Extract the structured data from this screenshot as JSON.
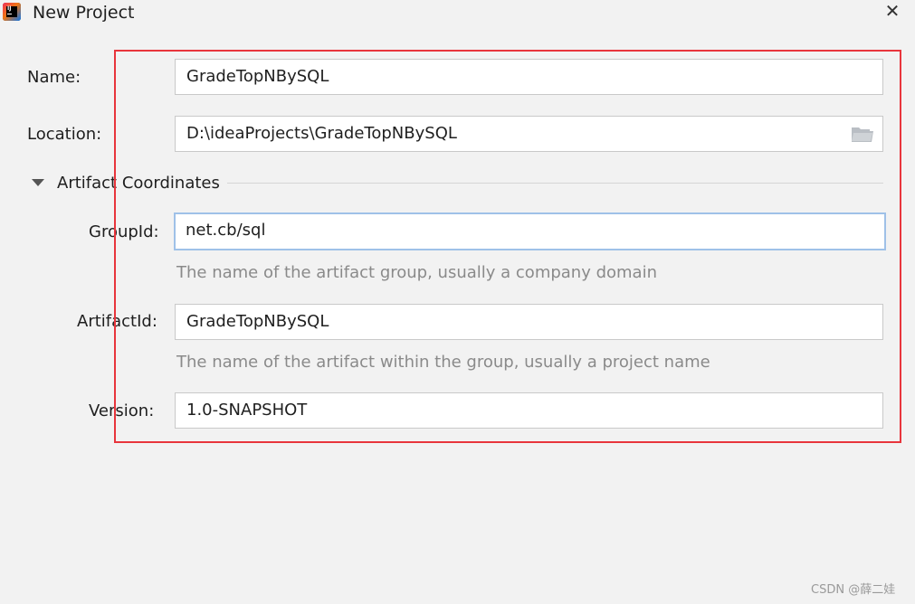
{
  "window": {
    "title": "New Project",
    "close_icon": "close-icon"
  },
  "form": {
    "name_label": "Name:",
    "name_value": "GradeTopNBySQL",
    "location_label": "Location:",
    "location_value": "D:\\ideaProjects\\GradeTopNBySQL",
    "location_icon": "folder-icon"
  },
  "artifact": {
    "section_title": "Artifact Coordinates",
    "group_label": "GroupId:",
    "group_value": "net.cb/sql",
    "group_hint": "The name of the artifact group, usually a company domain",
    "artifact_label": "ArtifactId:",
    "artifact_value": "GradeTopNBySQL",
    "artifact_hint": "The name of the artifact within the group, usually a project name",
    "version_label": "Version:",
    "version_value": "1.0-SNAPSHOT"
  },
  "colors": {
    "highlight": "#e8353c",
    "focus_border": "#9fc1e8",
    "background": "#f2f2f2"
  },
  "watermark": "CSDN @薛二娃"
}
